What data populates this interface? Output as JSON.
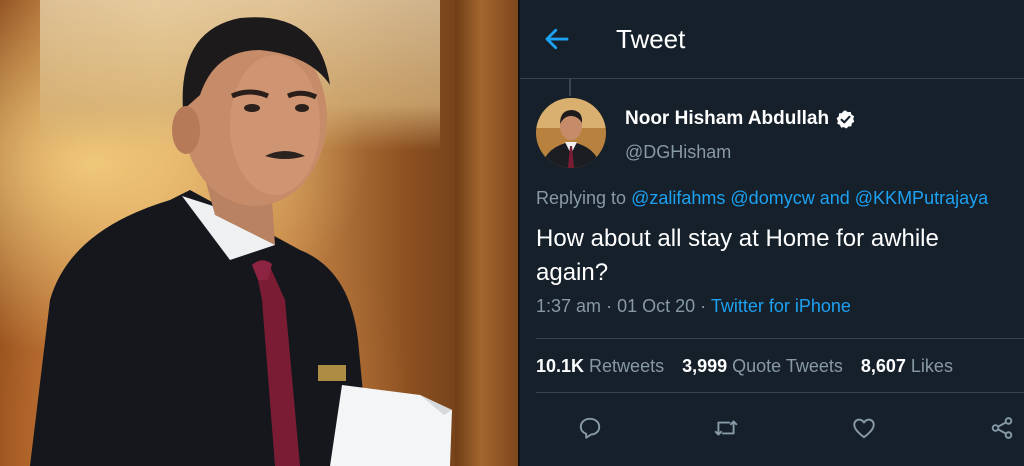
{
  "header": {
    "title": "Tweet",
    "back_icon": "arrow-left-icon"
  },
  "tweet": {
    "author_name": "Noor Hisham Abdullah",
    "author_handle": "@DGHisham",
    "verified_icon": "verified-badge-icon",
    "replying_prefix": "Replying to",
    "mentions": [
      "@zalifahms",
      "@domycw",
      "@KKMPutrajaya"
    ],
    "and_word": "and",
    "text": "How about all stay at Home for awhile again?",
    "time": "1:37 am",
    "date": "01 Oct 20",
    "dot": "·",
    "source": "Twitter for iPhone"
  },
  "stats": {
    "retweets_count": "10.1K",
    "retweets_label": "Retweets",
    "quote_tweets_count": "3,999",
    "quote_tweets_label": "Quote Tweets",
    "likes_count": "8,607",
    "likes_label": "Likes"
  },
  "actions": {
    "reply_icon": "reply-icon",
    "retweet_icon": "retweet-icon",
    "like_icon": "heart-icon",
    "share_icon": "share-icon"
  },
  "colors": {
    "background": "#15202b",
    "accent": "#1da1f2",
    "secondary_text": "#8899a6",
    "border": "#38444d"
  }
}
